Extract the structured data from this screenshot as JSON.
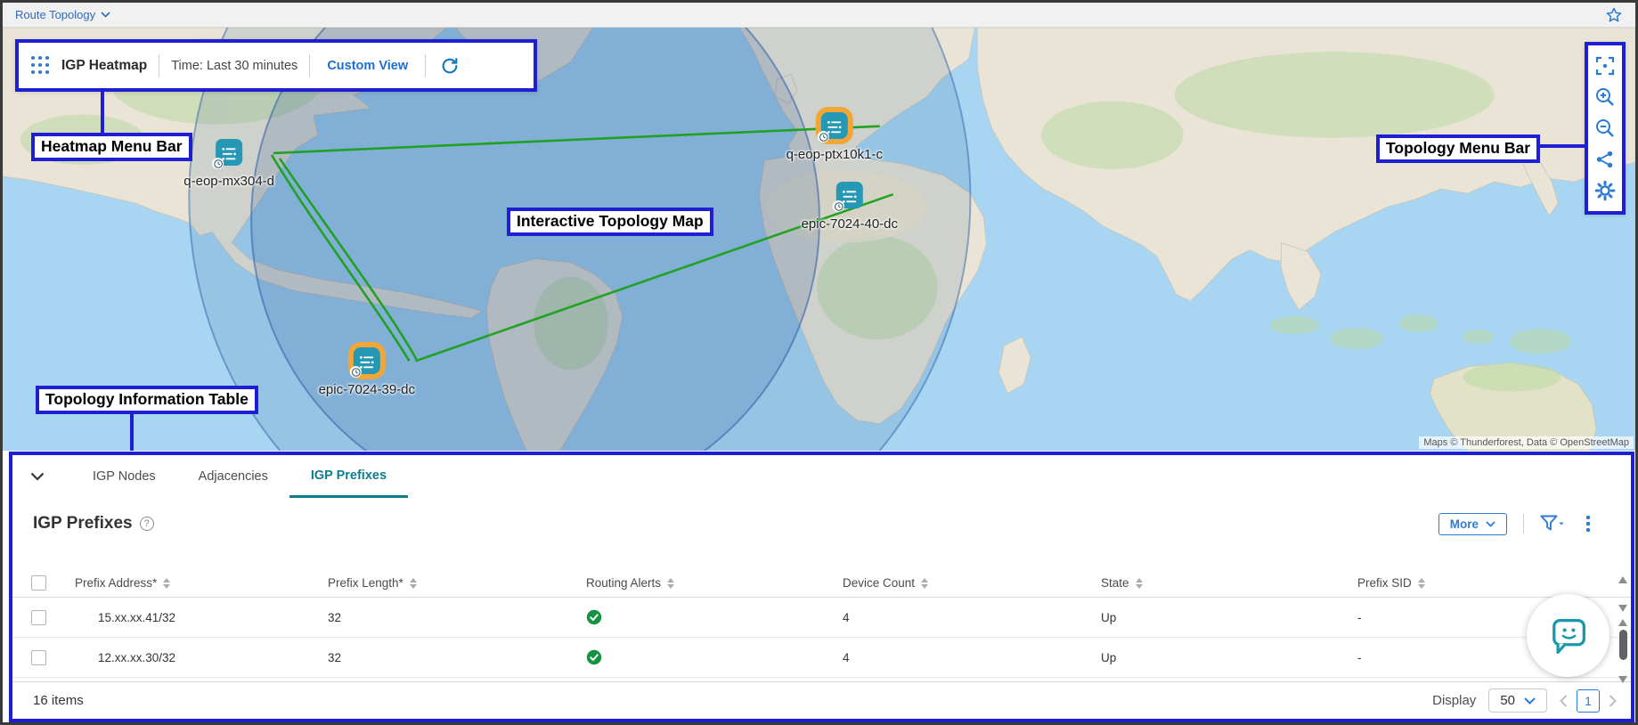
{
  "app": {
    "breadcrumb": "Route Topology"
  },
  "heatmap_menu": {
    "title": "IGP Heatmap",
    "time_label": "Time: Last 30 minutes",
    "custom_view_label": "Custom View",
    "icons": [
      "grid-handle-icon",
      "refresh-icon"
    ]
  },
  "annotations": {
    "heatmap_menu_bar": "Heatmap Menu Bar",
    "topology_menu_bar": "Topology Menu Bar",
    "interactive_topology_map": "Interactive Topology Map",
    "topology_information_table": "Topology Information Table",
    "accent_color": "#1e1ed2"
  },
  "topology_toolbar": {
    "icons": [
      "fit-screen-icon",
      "zoom-in-icon",
      "zoom-out-icon",
      "share-icon",
      "gear-icon"
    ]
  },
  "map": {
    "nodes": [
      {
        "label": "q-eop-mx304-d",
        "highlighted": false
      },
      {
        "label": "q-eop-ptx10k1-c",
        "highlighted": true
      },
      {
        "label": "epic-7024-40-dc",
        "highlighted": false
      },
      {
        "label": "epic-7024-39-dc",
        "highlighted": true
      }
    ],
    "attribution": "Maps © Thunderforest, Data © OpenStreetMap",
    "link_color": "#1ba11b",
    "node_color": "#2498b5",
    "highlight_color": "#f2a638"
  },
  "table_panel": {
    "tabs": [
      {
        "label": "IGP Nodes",
        "active": false
      },
      {
        "label": "Adjacencies",
        "active": false
      },
      {
        "label": "IGP Prefixes",
        "active": true
      }
    ],
    "section_title": "IGP Prefixes",
    "more_button": "More",
    "columns": [
      "Prefix Address*",
      "Prefix Length*",
      "Routing Alerts",
      "Device Count",
      "State",
      "Prefix SID"
    ],
    "rows": [
      {
        "prefix_address": "15.xx.xx.41/32",
        "prefix_length": "32",
        "routing_alert": "ok",
        "device_count": "4",
        "state": "Up",
        "prefix_sid": "-"
      },
      {
        "prefix_address": "12.xx.xx.30/32",
        "prefix_length": "32",
        "routing_alert": "ok",
        "device_count": "4",
        "state": "Up",
        "prefix_sid": "-"
      }
    ],
    "footer": {
      "items_count": "16 items",
      "display_label": "Display",
      "page_size": "50",
      "current_page": "1"
    }
  }
}
